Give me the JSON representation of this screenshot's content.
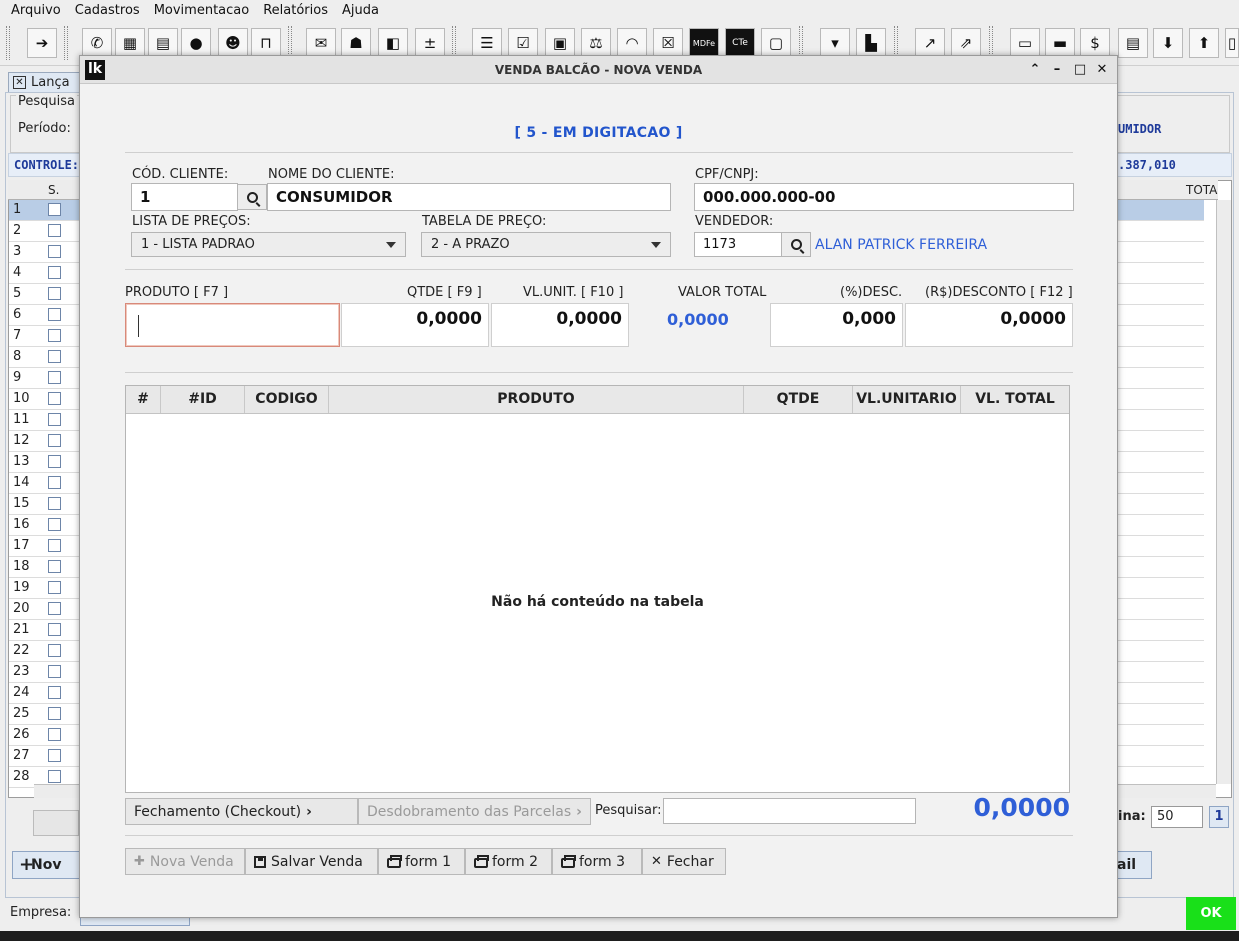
{
  "menu": [
    "Arquivo",
    "Cadastros",
    "Movimentacao",
    "Relatórios",
    "Ajuda"
  ],
  "toolbar_icons": [
    "exit-icon",
    "whatsapp-icon",
    "calculator-icon",
    "document-icon",
    "chat-icon",
    "users-icon",
    "unlock-icon",
    "mail-icon",
    "user-icon",
    "box-icon",
    "calc-ops-icon",
    "menu-icon",
    "checklist-icon",
    "truck-icon",
    "scale-icon",
    "rss-icon",
    "close-x-icon",
    "mdfe-icon",
    "cte-icon",
    "clipboard-icon",
    "cart-icon",
    "register-icon",
    "chart-up-icon",
    "chart-up2-icon",
    "cash-icon",
    "money-icon",
    "money-bag-icon",
    "form-icon",
    "box-down-icon",
    "box-up-icon",
    "more-icon"
  ],
  "toolbar_text": {
    "mdfe": "MDFe",
    "cte": "CTe"
  },
  "background": {
    "tab_label": "Lança",
    "search_group": "Pesquisa",
    "periodo_label": "Período:",
    "consumidor_fragment": "UMIDOR",
    "controle_label": "CONTROLE:",
    "controle_value_fragment": ".387,010",
    "grid_header_s": "S.",
    "grid_header_total": "TOTA",
    "row_numbers": [
      "1",
      "2",
      "3",
      "4",
      "5",
      "6",
      "7",
      "8",
      "9",
      "10",
      "11",
      "12",
      "13",
      "14",
      "15",
      "16",
      "17",
      "18",
      "19",
      "20",
      "21",
      "22",
      "23",
      "24",
      "25",
      "26",
      "27",
      "28"
    ],
    "pagination_label": "ina:",
    "pagination_size": "50",
    "pagination_page": "1",
    "novo_button": "Nov",
    "email_button_fragment": "ail",
    "empresa_label": "Empresa:",
    "ok_label": "OK"
  },
  "dialog": {
    "title": "VENDA BALCÃO - NOVA VENDA",
    "logo": "lk",
    "status": "[ 5 - EM DIGITACAO ]",
    "customer": {
      "code_label": "CÓD. CLIENTE:",
      "code_value": "1",
      "name_label": "NOME DO CLIENTE:",
      "name_value": "CONSUMIDOR",
      "cpf_label": "CPF/CNPJ:",
      "cpf_value": "000.000.000-00"
    },
    "price_list_label": "LISTA DE PREÇOS:",
    "price_list_value": "1 - LISTA PADRAO",
    "price_table_label": "TABELA DE PREÇO:",
    "price_table_value": "2 - A PRAZO",
    "seller_label": "VENDEDOR:",
    "seller_code": "1173",
    "seller_name": "ALAN PATRICK FERREIRA",
    "entry": {
      "produto_label": "PRODUTO    [ F7 ]",
      "produto_value": "",
      "qtde_label": "QTDE   [ F9 ]",
      "qtde_value": "0,0000",
      "vlunit_label": "VL.UNIT.  [ F10 ]",
      "vlunit_value": "0,0000",
      "valor_total_label": "VALOR TOTAL",
      "valor_total_value": "0,0000",
      "desc_pct_label": "(%)DESC.",
      "desc_pct_value": "0,000",
      "desc_rs_label": "(R$)DESCONTO [ F12 ]",
      "desc_rs_value": "0,0000"
    },
    "table": {
      "columns": [
        "#",
        "#ID",
        "CODIGO",
        "PRODUTO",
        "QTDE",
        "VL.UNITARIO",
        "VL. TOTAL"
      ],
      "empty_message": "Não há conteúdo na tabela"
    },
    "checkout_button": "Fechamento (Checkout)",
    "installments_button": "Desdobramento das Parcelas",
    "search_label": "Pesquisar:",
    "search_value": "",
    "grand_total": "0,0000",
    "actions": {
      "nova_venda": "Nova Venda",
      "salvar_venda": "Salvar Venda",
      "form1": "form 1",
      "form2": "form 2",
      "form3": "form 3",
      "fechar": "Fechar"
    }
  }
}
